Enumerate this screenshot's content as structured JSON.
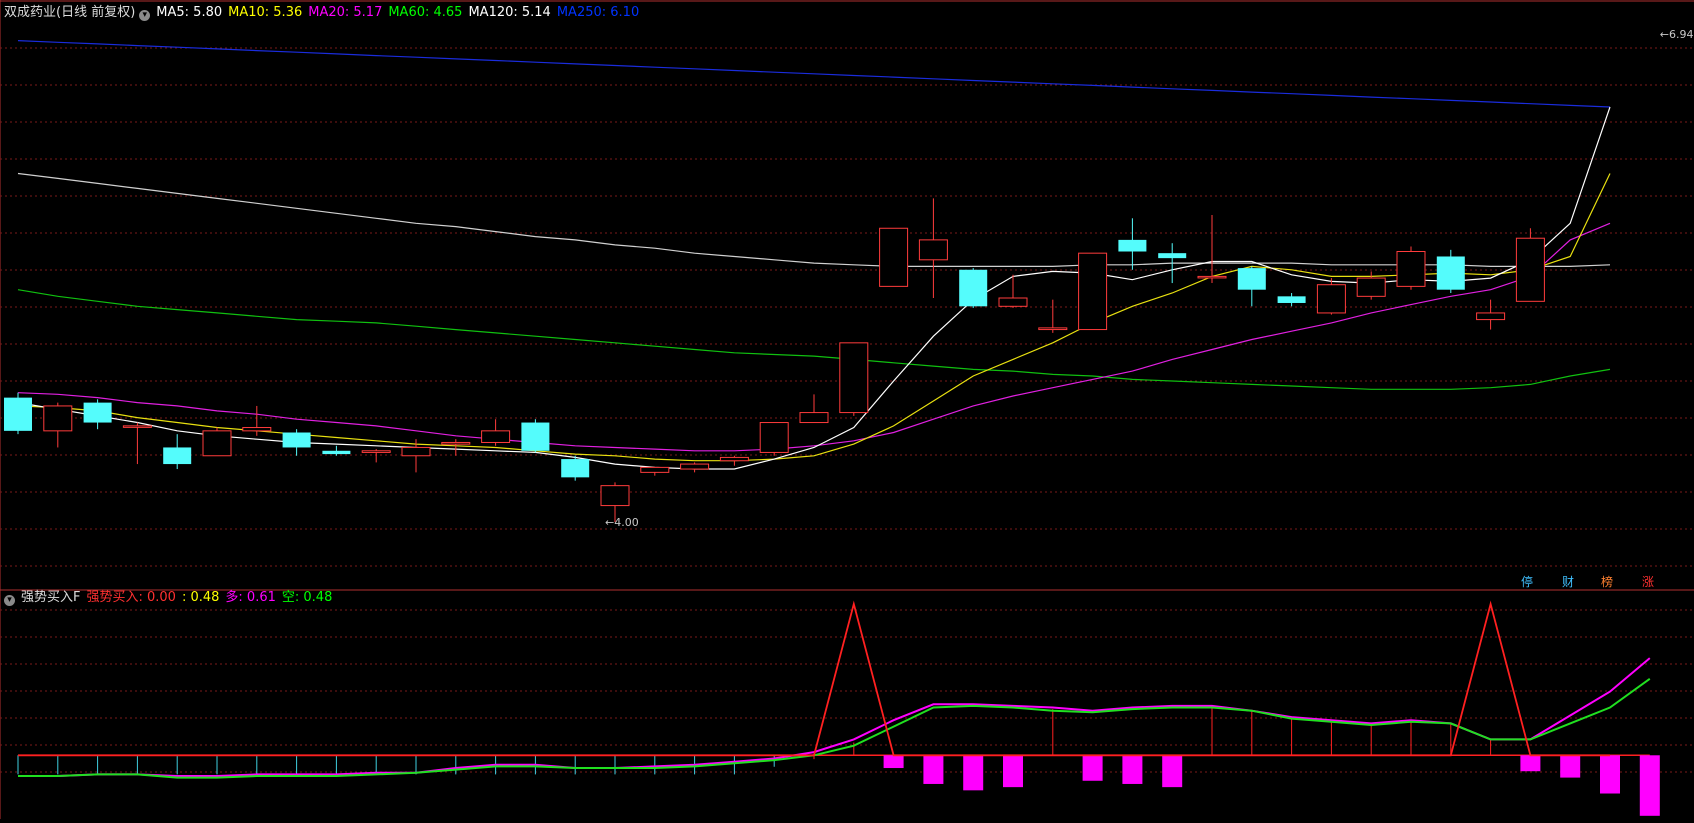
{
  "header_top": {
    "title": "双成药业(日线 前复权)",
    "ma_labels": [
      {
        "text": "MA5: 5.80",
        "color": "#ffffff"
      },
      {
        "text": "MA10: 5.36",
        "color": "#ffff00"
      },
      {
        "text": "MA20: 5.17",
        "color": "#ff00ff"
      },
      {
        "text": "MA60: 4.65",
        "color": "#00ff00"
      },
      {
        "text": "MA120: 5.14",
        "color": "#ffffff"
      },
      {
        "text": "MA250: 6.10",
        "color": "#0033ff"
      }
    ]
  },
  "header_bottom": {
    "title": "强势买入F",
    "labels": [
      {
        "text": "强势买入: 0.00",
        "color": "#ff3030"
      },
      {
        "text": ": 0.48",
        "color": "#ffff00"
      },
      {
        "text": "多: 0.61",
        "color": "#ff00ff"
      },
      {
        "text": "空: 0.48",
        "color": "#00ff00"
      }
    ]
  },
  "badges": [
    {
      "text": "停",
      "color": "#40c0ff"
    },
    {
      "text": "财",
      "color": "#40c0ff"
    },
    {
      "text": "榜",
      "color": "#ff8030"
    },
    {
      "text": "涨",
      "color": "#ff3030"
    }
  ],
  "chart_data": [
    {
      "type": "candlestick",
      "y_range": [
        3.7,
        7.0
      ],
      "annotations": [
        {
          "text": "←6.94",
          "price": 6.94,
          "candle_index": 41
        },
        {
          "text": "←4.00",
          "price": 4.0,
          "candle_index": 15
        }
      ],
      "candles": [
        {
          "o": 4.75,
          "h": 4.78,
          "l": 4.53,
          "c": 4.55
        },
        {
          "o": 4.55,
          "h": 4.72,
          "l": 4.45,
          "c": 4.7
        },
        {
          "o": 4.72,
          "h": 4.74,
          "l": 4.56,
          "c": 4.6
        },
        {
          "o": 4.58,
          "h": 4.6,
          "l": 4.35,
          "c": 4.58
        },
        {
          "o": 4.45,
          "h": 4.53,
          "l": 4.32,
          "c": 4.35
        },
        {
          "o": 4.4,
          "h": 4.57,
          "l": 4.4,
          "c": 4.55
        },
        {
          "o": 4.55,
          "h": 4.7,
          "l": 4.52,
          "c": 4.57
        },
        {
          "o": 4.54,
          "h": 4.56,
          "l": 4.4,
          "c": 4.45
        },
        {
          "o": 4.43,
          "h": 4.46,
          "l": 4.4,
          "c": 4.41
        },
        {
          "o": 4.42,
          "h": 4.44,
          "l": 4.36,
          "c": 4.43
        },
        {
          "o": 4.4,
          "h": 4.5,
          "l": 4.3,
          "c": 4.45
        },
        {
          "o": 4.47,
          "h": 4.5,
          "l": 4.4,
          "c": 4.48
        },
        {
          "o": 4.48,
          "h": 4.62,
          "l": 4.46,
          "c": 4.55
        },
        {
          "o": 4.6,
          "h": 4.62,
          "l": 4.42,
          "c": 4.43
        },
        {
          "o": 4.38,
          "h": 4.4,
          "l": 4.25,
          "c": 4.27
        },
        {
          "o": 4.1,
          "h": 4.24,
          "l": 4.0,
          "c": 4.22
        },
        {
          "o": 4.3,
          "h": 4.33,
          "l": 4.28,
          "c": 4.33
        },
        {
          "o": 4.32,
          "h": 4.36,
          "l": 4.3,
          "c": 4.35
        },
        {
          "o": 4.37,
          "h": 4.4,
          "l": 4.34,
          "c": 4.39
        },
        {
          "o": 4.42,
          "h": 4.6,
          "l": 4.4,
          "c": 4.6
        },
        {
          "o": 4.6,
          "h": 4.77,
          "l": 4.6,
          "c": 4.66
        },
        {
          "o": 4.66,
          "h": 5.08,
          "l": 4.64,
          "c": 5.08
        },
        {
          "o": 5.42,
          "h": 5.77,
          "l": 5.42,
          "c": 5.77
        },
        {
          "o": 5.58,
          "h": 5.95,
          "l": 5.35,
          "c": 5.7
        },
        {
          "o": 5.52,
          "h": 5.53,
          "l": 5.29,
          "c": 5.3
        },
        {
          "o": 5.3,
          "h": 5.49,
          "l": 5.29,
          "c": 5.35
        },
        {
          "o": 5.16,
          "h": 5.34,
          "l": 5.14,
          "c": 5.17
        },
        {
          "o": 5.16,
          "h": 5.62,
          "l": 5.16,
          "c": 5.62
        },
        {
          "o": 5.7,
          "h": 5.83,
          "l": 5.52,
          "c": 5.63
        },
        {
          "o": 5.62,
          "h": 5.68,
          "l": 5.44,
          "c": 5.59
        },
        {
          "o": 5.48,
          "h": 5.85,
          "l": 5.44,
          "c": 5.48
        },
        {
          "o": 5.53,
          "h": 5.54,
          "l": 5.3,
          "c": 5.4
        },
        {
          "o": 5.36,
          "h": 5.38,
          "l": 5.3,
          "c": 5.32
        },
        {
          "o": 5.26,
          "h": 5.47,
          "l": 5.25,
          "c": 5.43
        },
        {
          "o": 5.36,
          "h": 5.51,
          "l": 5.34,
          "c": 5.47
        },
        {
          "o": 5.42,
          "h": 5.66,
          "l": 5.4,
          "c": 5.63
        },
        {
          "o": 5.6,
          "h": 5.64,
          "l": 5.38,
          "c": 5.4
        },
        {
          "o": 5.22,
          "h": 5.34,
          "l": 5.16,
          "c": 5.26
        },
        {
          "o": 5.33,
          "h": 5.77,
          "l": 5.33,
          "c": 5.71
        }
      ],
      "ma": {
        "ma5": [
          4.72,
          4.68,
          4.64,
          4.6,
          4.55,
          4.52,
          4.5,
          4.48,
          4.47,
          4.46,
          4.45,
          4.44,
          4.43,
          4.42,
          4.39,
          4.35,
          4.33,
          4.32,
          4.32,
          4.38,
          4.45,
          4.57,
          4.85,
          5.12,
          5.34,
          5.48,
          5.51,
          5.5,
          5.46,
          5.52,
          5.57,
          5.57,
          5.49,
          5.45,
          5.44,
          5.46,
          5.45,
          5.47,
          5.58,
          5.8
        ],
        "ma10": [
          4.7,
          4.69,
          4.67,
          4.63,
          4.6,
          4.57,
          4.55,
          4.53,
          4.51,
          4.49,
          4.47,
          4.46,
          4.45,
          4.43,
          4.41,
          4.4,
          4.38,
          4.37,
          4.37,
          4.38,
          4.4,
          4.47,
          4.58,
          4.73,
          4.88,
          4.98,
          5.08,
          5.2,
          5.3,
          5.38,
          5.48,
          5.54,
          5.52,
          5.48,
          5.48,
          5.49,
          5.5,
          5.49,
          5.52,
          5.6
        ],
        "ma20": [
          4.78,
          4.77,
          4.75,
          4.72,
          4.7,
          4.67,
          4.65,
          4.62,
          4.6,
          4.58,
          4.55,
          4.52,
          4.5,
          4.48,
          4.46,
          4.45,
          4.44,
          4.43,
          4.43,
          4.44,
          4.46,
          4.49,
          4.54,
          4.62,
          4.7,
          4.76,
          4.81,
          4.86,
          4.91,
          4.98,
          5.04,
          5.1,
          5.15,
          5.2,
          5.26,
          5.31,
          5.36,
          5.4,
          5.48,
          5.7
        ],
        "ma60": [
          5.4,
          5.36,
          5.33,
          5.3,
          5.28,
          5.26,
          5.24,
          5.22,
          5.21,
          5.2,
          5.18,
          5.16,
          5.14,
          5.12,
          5.1,
          5.08,
          5.06,
          5.04,
          5.02,
          5.01,
          5.0,
          4.98,
          4.96,
          4.94,
          4.92,
          4.91,
          4.89,
          4.88,
          4.86,
          4.85,
          4.84,
          4.83,
          4.82,
          4.81,
          4.8,
          4.8,
          4.8,
          4.81,
          4.83,
          4.88
        ],
        "ma120": [
          6.1,
          6.07,
          6.04,
          6.01,
          5.98,
          5.95,
          5.92,
          5.89,
          5.86,
          5.83,
          5.8,
          5.78,
          5.75,
          5.72,
          5.7,
          5.67,
          5.65,
          5.62,
          5.6,
          5.58,
          5.56,
          5.55,
          5.54,
          5.54,
          5.54,
          5.54,
          5.54,
          5.55,
          5.55,
          5.56,
          5.56,
          5.56,
          5.56,
          5.55,
          5.55,
          5.55,
          5.55,
          5.54,
          5.54,
          5.54
        ],
        "ma250": [
          6.9,
          6.89,
          6.88,
          6.87,
          6.86,
          6.85,
          6.84,
          6.83,
          6.82,
          6.81,
          6.8,
          6.79,
          6.78,
          6.77,
          6.76,
          6.75,
          6.74,
          6.73,
          6.72,
          6.71,
          6.7,
          6.69,
          6.68,
          6.67,
          6.66,
          6.65,
          6.64,
          6.63,
          6.62,
          6.61,
          6.6,
          6.59,
          6.58,
          6.57,
          6.56,
          6.55,
          6.54,
          6.53,
          6.52,
          6.51
        ]
      },
      "extra_last_point": {
        "ma5": 6.5,
        "ma10": 6.1,
        "ma20": 5.8,
        "ma60": 4.92,
        "ma120": 5.55,
        "ma250": 6.5
      }
    },
    {
      "type": "indicator",
      "y_range": [
        -0.4,
        1.0
      ],
      "strong_buy": [
        0,
        0,
        0,
        0,
        0,
        0,
        0,
        0,
        0,
        0,
        0,
        0,
        0,
        0,
        0,
        0,
        0,
        0,
        0,
        0,
        0,
        1,
        0,
        0,
        0,
        0,
        0,
        0,
        0,
        0,
        0,
        0,
        0,
        0,
        0,
        0,
        0,
        1,
        0,
        0,
        0
      ],
      "duo": [
        -0.13,
        -0.13,
        -0.12,
        -0.12,
        -0.13,
        -0.13,
        -0.12,
        -0.12,
        -0.12,
        -0.11,
        -0.11,
        -0.08,
        -0.06,
        -0.06,
        -0.08,
        -0.08,
        -0.07,
        -0.06,
        -0.04,
        -0.02,
        0.02,
        0.1,
        0.22,
        0.32,
        0.32,
        0.31,
        0.3,
        0.28,
        0.3,
        0.31,
        0.31,
        0.28,
        0.24,
        0.22,
        0.2,
        0.22,
        0.2,
        0.1,
        0.1,
        0.25,
        0.4,
        0.61
      ],
      "kong": [
        -0.13,
        -0.13,
        -0.12,
        -0.12,
        -0.14,
        -0.14,
        -0.13,
        -0.13,
        -0.13,
        -0.12,
        -0.11,
        -0.09,
        -0.07,
        -0.07,
        -0.08,
        -0.08,
        -0.08,
        -0.07,
        -0.05,
        -0.03,
        0.0,
        0.06,
        0.18,
        0.3,
        0.31,
        0.3,
        0.28,
        0.27,
        0.29,
        0.3,
        0.3,
        0.28,
        0.23,
        0.21,
        0.19,
        0.21,
        0.2,
        0.1,
        0.1,
        0.2,
        0.3,
        0.48
      ],
      "bars": [
        -0.05,
        -0.05,
        -0.05,
        -0.05,
        -0.05,
        -0.05,
        -0.05,
        -0.05,
        -0.05,
        -0.05,
        -0.05,
        -0.05,
        -0.05,
        -0.05,
        -0.05,
        -0.05,
        -0.05,
        -0.05,
        -0.05,
        -0.03,
        -0.01,
        0.0,
        -0.08,
        -0.18,
        -0.22,
        -0.2,
        0.0,
        -0.16,
        -0.18,
        -0.2,
        0.0,
        0.0,
        0.0,
        0.0,
        0.0,
        0.0,
        0.0,
        0.0,
        -0.1,
        -0.14,
        -0.24,
        -0.38
      ]
    }
  ]
}
